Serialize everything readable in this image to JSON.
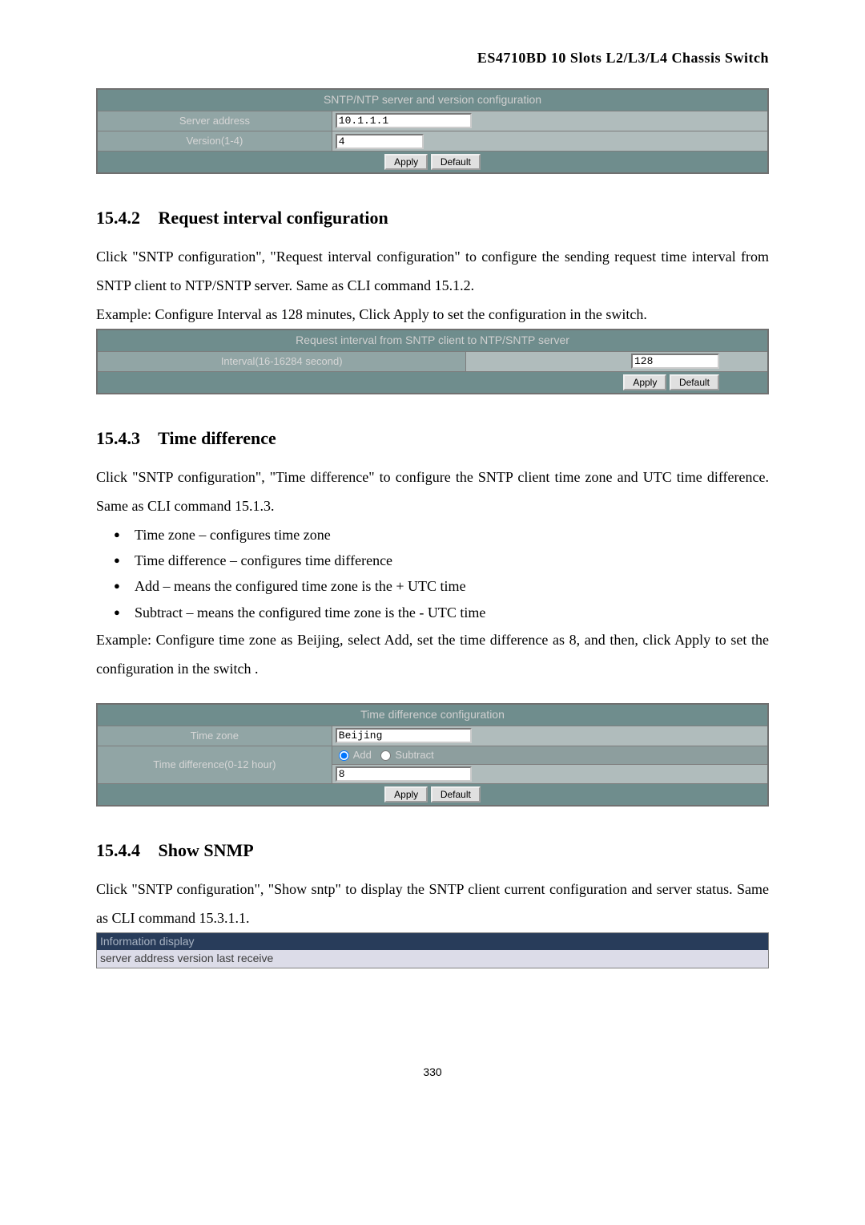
{
  "header": "ES4710BD 10 Slots L2/L3/L4 Chassis Switch",
  "sntp_table": {
    "title": "SNTP/NTP server and version configuration",
    "rows": {
      "server_address_label": "Server address",
      "server_address_value": "10.1.1.1",
      "version_label": "Version(1-4)",
      "version_value": "4"
    },
    "apply": "Apply",
    "default": "Default"
  },
  "section_1542": {
    "num": "15.4.2",
    "title": "Request interval configuration",
    "para1": "Click \"SNTP configuration\", \"Request interval configuration\" to configure the sending request time interval from SNTP client to NTP/SNTP server. Same as CLI command 15.1.2.",
    "para2": "Example: Configure Interval as 128 minutes, Click Apply to set the configuration in the switch."
  },
  "interval_table": {
    "title": "Request interval from SNTP client to NTP/SNTP server",
    "label": "Interval(16-16284 second)",
    "value": "128",
    "apply": "Apply",
    "default": "Default"
  },
  "section_1543": {
    "num": "15.4.3",
    "title": "Time difference",
    "para1": "Click \"SNTP configuration\", \"Time difference\" to configure the SNTP client time zone and UTC time difference. Same as CLI command 15.1.3.",
    "bullets": [
      "Time zone – configures time zone",
      "Time difference – configures time difference",
      "Add – means the configured time zone is the + UTC time",
      "Subtract – means the configured time zone is the - UTC time"
    ],
    "para2": "Example: Configure time zone as Beijing, select Add, set the time difference as 8, and then, click Apply to set the configuration in the switch ."
  },
  "timediff_table": {
    "title": "Time difference configuration",
    "timezone_label": "Time zone",
    "timezone_value": "Beijing",
    "diff_label": "Time difference(0-12 hour)",
    "radio_add": "Add",
    "radio_sub": "Subtract",
    "diff_value": "8",
    "apply": "Apply",
    "default": "Default"
  },
  "section_1544": {
    "num": "15.4.4",
    "title": "Show SNMP",
    "para1": "Click \"SNTP configuration\", \"Show sntp\" to display the SNTP client current configuration and server status. Same as CLI command 15.3.1.1."
  },
  "info_table": {
    "title": "Information display",
    "columns": "server address  version  last receive"
  },
  "page_num": "330"
}
